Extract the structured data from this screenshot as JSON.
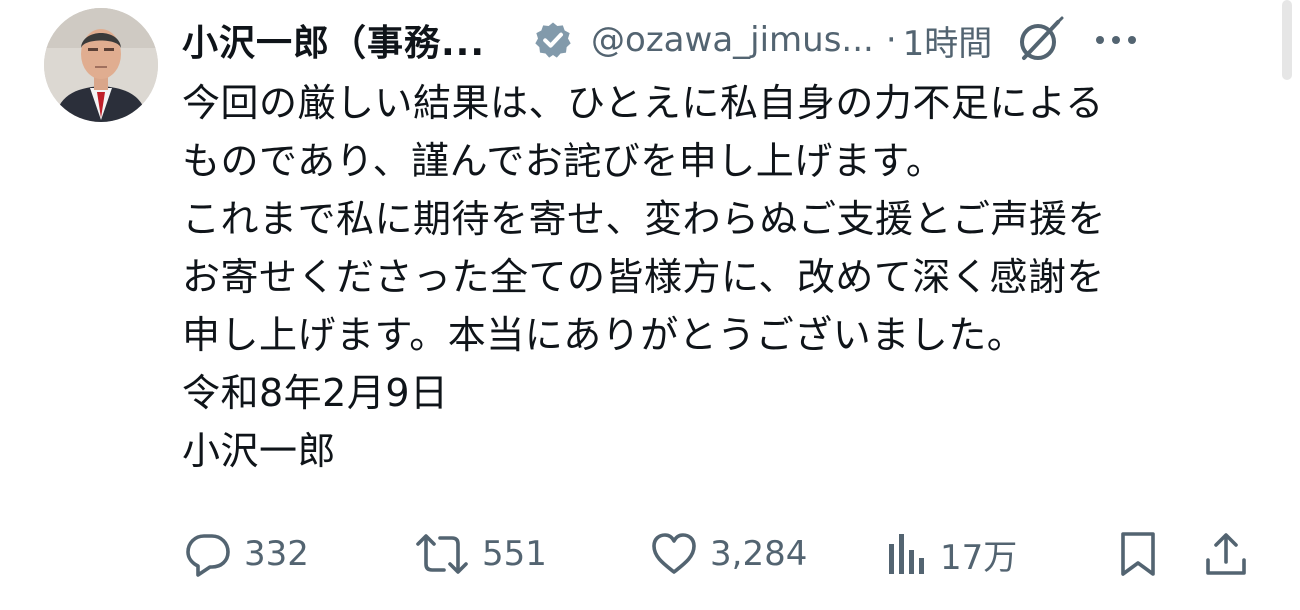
{
  "tweet": {
    "author_name": "小沢一郎（事務...",
    "handle": "@ozawa_jimus...",
    "separator": "·",
    "time": "1時間",
    "verified": true,
    "body_lines": [
      "今回の厳しい結果は、ひとえに私自身の力不足による",
      "ものであり、謹んでお詫びを申し上げます。",
      "これまで私に期待を寄せ、変わらぬご支援とご声援を",
      "お寄せくださった全ての皆様方に、改めて深く感謝を",
      "申し上げます。本当にありがとうございました。",
      "令和8年2月9日",
      "小沢一郎"
    ],
    "replies": "332",
    "reposts": "551",
    "likes": "3,284",
    "views": "17万"
  },
  "icons": {
    "verified": "verified-badge-icon",
    "grok": "grok-icon",
    "more": "more-icon",
    "reply": "reply-icon",
    "repost": "repost-icon",
    "like": "like-icon",
    "views": "views-icon",
    "bookmark": "bookmark-icon",
    "share": "share-icon"
  },
  "colors": {
    "text": "#0f1419",
    "secondary": "#536471",
    "badge": "#829aab"
  }
}
